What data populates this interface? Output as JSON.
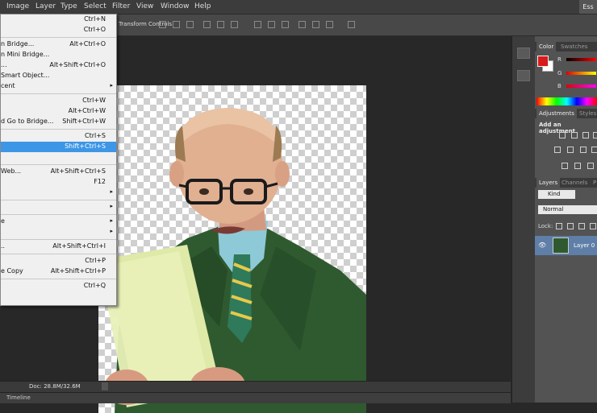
{
  "menubar": {
    "items": [
      "Image",
      "Layer",
      "Type",
      "Select",
      "Filter",
      "View",
      "Window",
      "Help"
    ],
    "workspace_label": "Ess"
  },
  "options_bar": {
    "label": "Transform Controls"
  },
  "file_menu": [
    {
      "label": "",
      "shortcut": "Ctrl+N"
    },
    {
      "label": "",
      "shortcut": "Ctrl+O"
    },
    {
      "label": "n Bridge...",
      "shortcut": "Alt+Ctrl+O"
    },
    {
      "label": "n Mini Bridge...",
      "shortcut": ""
    },
    {
      "label": "...",
      "shortcut": "Alt+Shift+Ctrl+O"
    },
    {
      "label": "Smart Object...",
      "shortcut": ""
    },
    {
      "label": "cent",
      "shortcut": "",
      "submenu": true
    },
    {
      "label": "",
      "shortcut": "Ctrl+W"
    },
    {
      "label": "",
      "shortcut": "Alt+Ctrl+W"
    },
    {
      "label": "d Go to Bridge...",
      "shortcut": "Shift+Ctrl+W"
    },
    {
      "label": "",
      "shortcut": "Ctrl+S"
    },
    {
      "label": "",
      "shortcut": "Shift+Ctrl+S",
      "highlight": true
    },
    {
      "label": "",
      "shortcut": ""
    },
    {
      "label": "Web...",
      "shortcut": "Alt+Shift+Ctrl+S"
    },
    {
      "label": "",
      "shortcut": "F12"
    },
    {
      "label": "",
      "shortcut": "",
      "submenu": true
    },
    {
      "label": "",
      "shortcut": "",
      "submenu": true
    },
    {
      "label": "e",
      "shortcut": "",
      "submenu": true
    },
    {
      "label": "",
      "shortcut": "",
      "submenu": true
    },
    {
      "label": "..",
      "shortcut": "Alt+Shift+Ctrl+I"
    },
    {
      "label": "",
      "shortcut": "Ctrl+P"
    },
    {
      "label": "e Copy",
      "shortcut": "Alt+Shift+Ctrl+P"
    },
    {
      "label": "",
      "shortcut": "Ctrl+Q"
    }
  ],
  "statusbar": {
    "doc": "Doc: 28.8M/32.6M"
  },
  "timeline": {
    "label": "Timeline"
  },
  "color_panel": {
    "tabs": [
      "Color",
      "Swatches"
    ],
    "channels": [
      "R",
      "G",
      "B"
    ],
    "foreground": "#d81b1b",
    "background": "#ffffff"
  },
  "adjustments_panel": {
    "tabs": [
      "Adjustments",
      "Styles"
    ],
    "heading": "Add an adjustment"
  },
  "layers_panel": {
    "tabs": [
      "Layers",
      "Channels",
      "P"
    ],
    "filter": "Kind",
    "blend_mode": "Normal",
    "lock_label": "Lock:",
    "layer_name": "Layer 0"
  },
  "colors": {
    "accent": "#3d96e6",
    "suit": "#2f5a2f",
    "paper": "#dfe9a8"
  }
}
